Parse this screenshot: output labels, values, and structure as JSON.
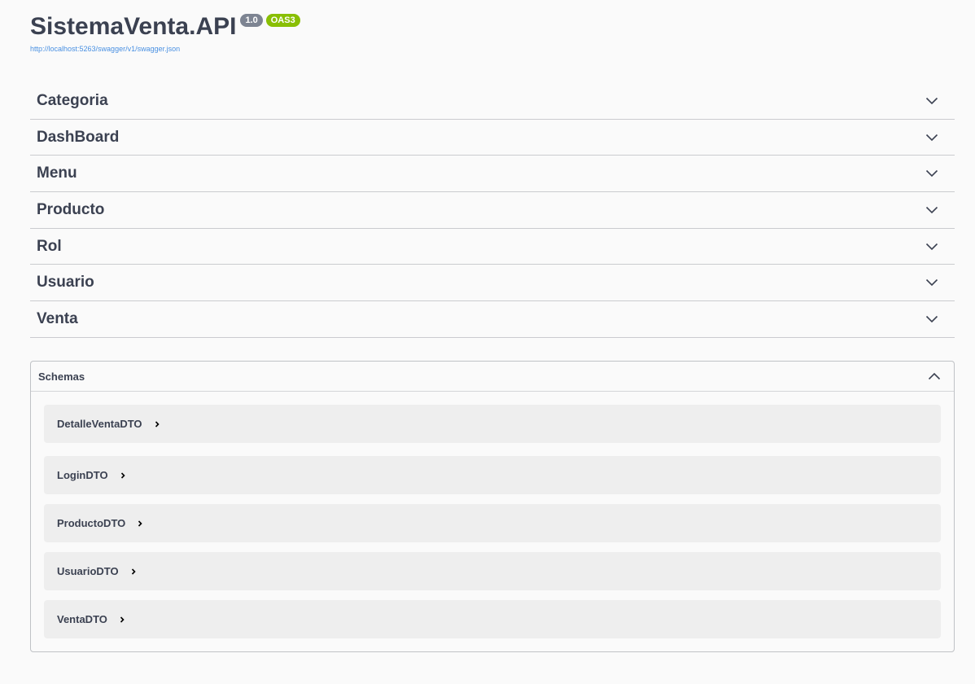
{
  "info": {
    "title": "SistemaVenta.API",
    "version": "1.0",
    "oas": "OAS3",
    "spec_url": "http://localhost:5263/swagger/v1/swagger.json"
  },
  "tags": [
    {
      "label": "Categoria",
      "icon": "chevron-down-icon"
    },
    {
      "label": "DashBoard",
      "icon": "chevron-down-icon"
    },
    {
      "label": "Menu",
      "icon": "chevron-down-icon"
    },
    {
      "label": "Producto",
      "icon": "chevron-down-icon"
    },
    {
      "label": "Rol",
      "icon": "chevron-down-icon"
    },
    {
      "label": "Usuario",
      "icon": "chevron-down-icon"
    },
    {
      "label": "Venta",
      "icon": "chevron-down-icon"
    }
  ],
  "schemas": {
    "label": "Schemas",
    "icon": "chevron-up-icon",
    "models": [
      {
        "name": "DetalleVentaDTO",
        "icon": "chevron-right-icon"
      },
      {
        "name": "LoginDTO",
        "icon": "chevron-right-icon"
      },
      {
        "name": "ProductoDTO",
        "icon": "chevron-right-icon"
      },
      {
        "name": "UsuarioDTO",
        "icon": "chevron-right-icon"
      },
      {
        "name": "VentaDTO",
        "icon": "chevron-right-icon"
      }
    ]
  },
  "colors": {
    "text": "#3b4151",
    "link": "#4990e2",
    "version_badge": "#7d8492",
    "oas_badge": "#89bf04",
    "model_bg": "#eeeeee"
  }
}
